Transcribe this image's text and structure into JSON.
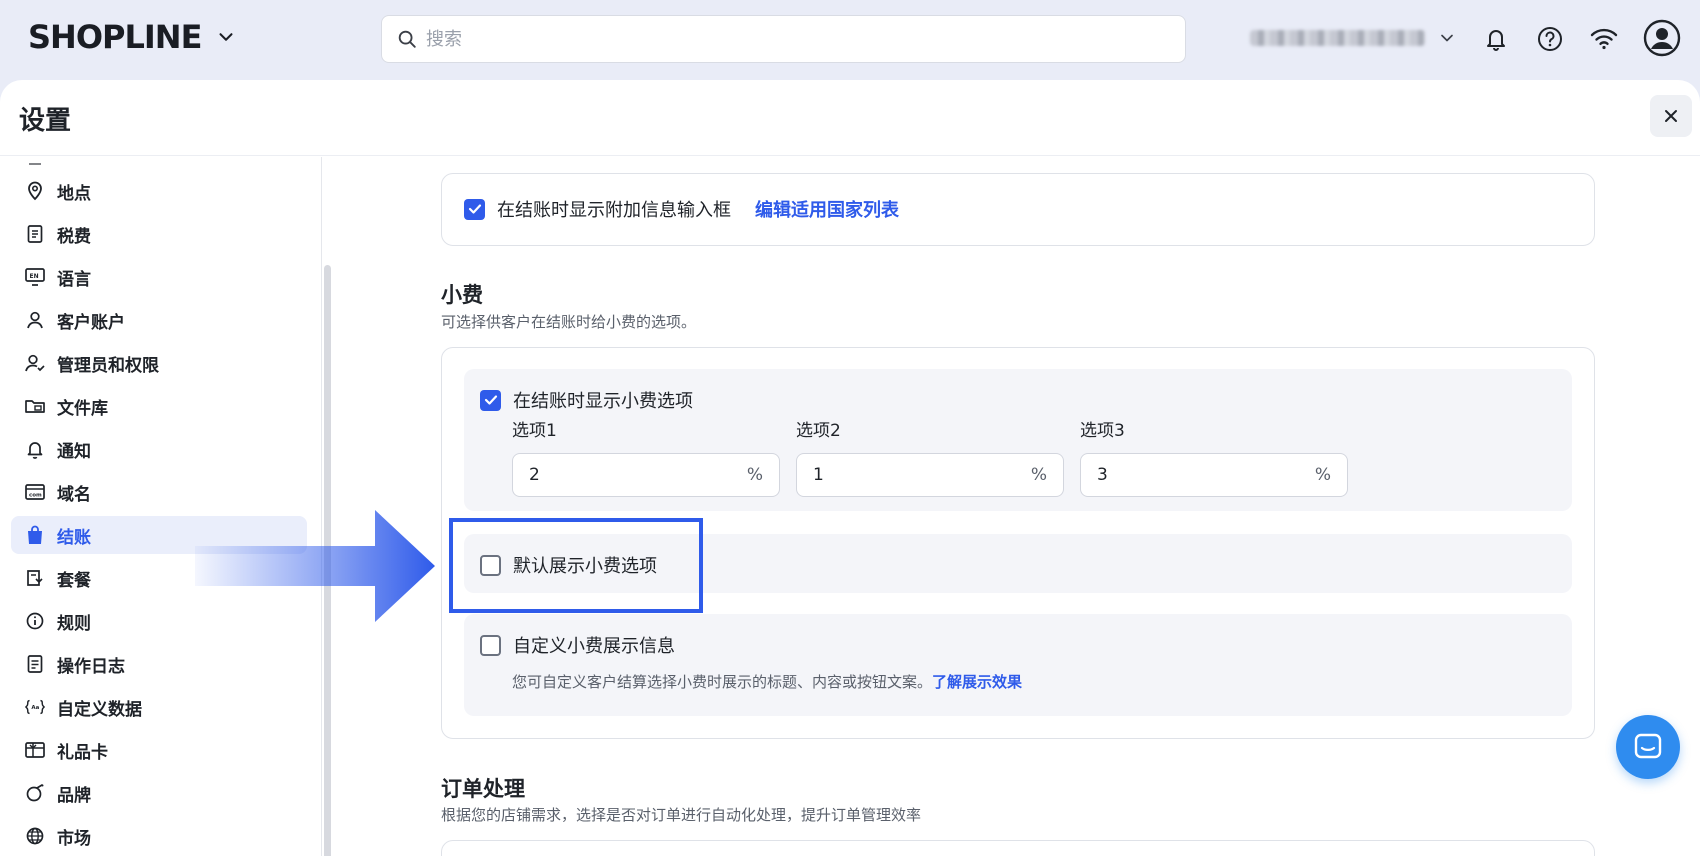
{
  "brand": {
    "logo_text": "SHOPLINE"
  },
  "search": {
    "placeholder": "搜索"
  },
  "panel": {
    "title": "设置"
  },
  "sidebar": {
    "items": [
      {
        "label": "地点",
        "icon": "location-pin-icon"
      },
      {
        "label": "税费",
        "icon": "tax-icon"
      },
      {
        "label": "语言",
        "icon": "language-icon"
      },
      {
        "label": "客户账户",
        "icon": "user-icon"
      },
      {
        "label": "管理员和权限",
        "icon": "admin-permission-icon"
      },
      {
        "label": "文件库",
        "icon": "folder-icon"
      },
      {
        "label": "通知",
        "icon": "bell-icon"
      },
      {
        "label": "域名",
        "icon": "domain-icon"
      },
      {
        "label": "结账",
        "icon": "shopping-bag-icon",
        "active": true
      },
      {
        "label": "套餐",
        "icon": "plan-icon"
      },
      {
        "label": "规则",
        "icon": "info-icon"
      },
      {
        "label": "操作日志",
        "icon": "log-icon"
      },
      {
        "label": "自定义数据",
        "icon": "custom-data-icon"
      },
      {
        "label": "礼品卡",
        "icon": "gift-card-icon"
      },
      {
        "label": "品牌",
        "icon": "brand-icon"
      },
      {
        "label": "市场",
        "icon": "globe-icon"
      }
    ]
  },
  "extra_info": {
    "checkbox_label": "在结账时显示附加信息输入框",
    "checked": true,
    "link": "编辑适用国家列表"
  },
  "tips": {
    "title": "小费",
    "description": "可选择供客户在结账时给小费的选项。",
    "show_tips": {
      "label": "在结账时显示小费选项",
      "checked": true
    },
    "options": [
      {
        "label": "选项1",
        "value": "2",
        "unit": "%"
      },
      {
        "label": "选项2",
        "value": "1",
        "unit": "%"
      },
      {
        "label": "选项3",
        "value": "3",
        "unit": "%"
      }
    ],
    "default_show": {
      "label": "默认展示小费选项",
      "checked": false
    },
    "custom_display": {
      "label": "自定义小费展示信息",
      "checked": false,
      "description": "您可自定义客户结算选择小费时展示的标题、内容或按钮文案。",
      "link": "了解展示效果"
    }
  },
  "order_processing": {
    "title": "订单处理",
    "description": "根据您的店铺需求，选择是否对订单进行自动化处理，提升订单管理效率"
  },
  "colors": {
    "accent": "#2f5bea",
    "highlight": "#2f5bea",
    "chat": "#2f8cef"
  }
}
